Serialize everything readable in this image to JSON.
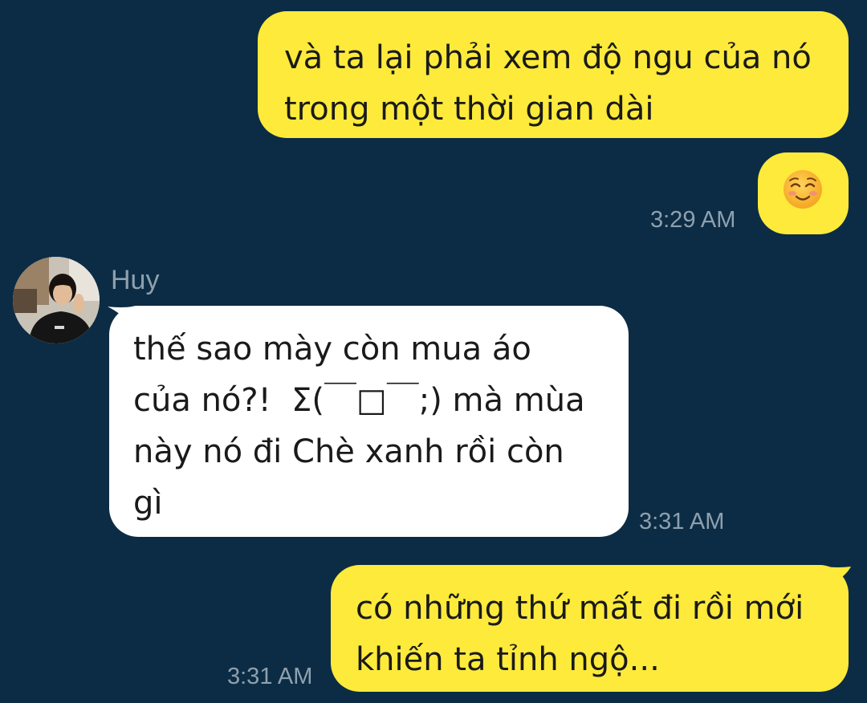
{
  "messages": [
    {
      "direction": "outgoing",
      "text": "và ta lại phải xem độ ngu của nó\ntrong một thời gian dài"
    },
    {
      "direction": "outgoing",
      "emoji": "☺️",
      "emoji_icon": "smiling-face-icon",
      "time": "3:29 AM"
    },
    {
      "direction": "incoming",
      "sender": "Huy",
      "text": "thế sao mày còn mua áo\ncủa nó?!  Σ(￣□￣;) mà mùa\nnày nó đi Chè xanh rồi còn\ngì",
      "time": "3:31 AM"
    },
    {
      "direction": "outgoing",
      "text": "có những thứ mất đi rồi mới\nkhiến ta tỉnh ngộ...",
      "time": "3:31 AM"
    }
  ],
  "colors": {
    "background": "#0c2c45",
    "outgoing_bubble": "#fdea3b",
    "incoming_bubble": "#ffffff",
    "meta_text": "#8ea0ae"
  }
}
